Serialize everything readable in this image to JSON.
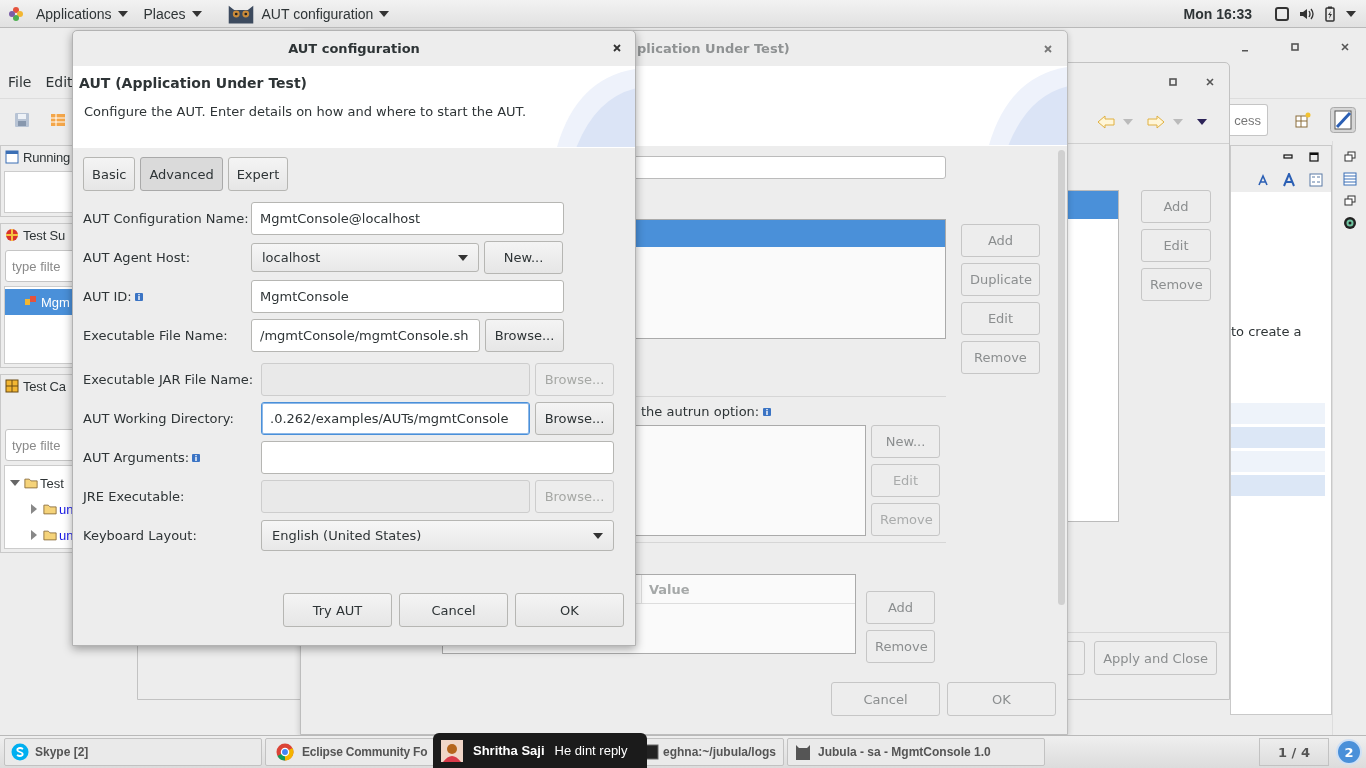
{
  "top_bar": {
    "menus": [
      {
        "label": "Applications"
      },
      {
        "label": "Places"
      }
    ],
    "active_window": "AUT configuration",
    "clock": "Mon 16:33"
  },
  "eclipse": {
    "menus": [
      "File",
      "Edit"
    ],
    "quick_access": "cess",
    "views": [
      {
        "title": "Running",
        "kind": "blank"
      },
      {
        "title": "Test Su",
        "kind": "list",
        "filter_placeholder": "type filte",
        "items": [
          {
            "label": "Mgm",
            "selected": true
          }
        ]
      },
      {
        "title": "Test Ca",
        "kind": "tree",
        "filter_placeholder": "type filte",
        "tree": [
          {
            "label": "Test",
            "expanded": true,
            "children": [
              {
                "label": "un",
                "expanded": false
              },
              {
                "label": "un",
                "expanded": false
              }
            ]
          }
        ]
      }
    ],
    "editor_text": "to create a"
  },
  "preferences": {
    "buttons": [
      {
        "label": "Add"
      },
      {
        "label": "Edit"
      },
      {
        "label": "Remove"
      }
    ],
    "footer_buttons": [
      "Apply and Close"
    ]
  },
  "aut_dialog": {
    "title": "plication Under Test)",
    "list_buttons": [
      {
        "label": "Add",
        "disabled": false
      },
      {
        "label": "Duplicate",
        "disabled": false
      },
      {
        "label": "Edit",
        "disabled": false
      },
      {
        "label": "Remove",
        "disabled": false
      }
    ],
    "autrun_label": "the autrun option:",
    "autrun_buttons": [
      {
        "label": "New...",
        "disabled": false
      },
      {
        "label": "Edit",
        "disabled": true
      },
      {
        "label": "Remove",
        "disabled": true
      }
    ],
    "table_column": "Value",
    "table_buttons": [
      {
        "label": "Add",
        "disabled": false
      },
      {
        "label": "Remove",
        "disabled": false
      }
    ],
    "footer_buttons": [
      "Cancel",
      "OK"
    ]
  },
  "config_dialog": {
    "title": "AUT configuration",
    "heading": "AUT (Application Under Test)",
    "description": "Configure the AUT. Enter details on how and where to start the AUT.",
    "tabs": [
      {
        "label": "Basic",
        "selected": false
      },
      {
        "label": "Advanced",
        "selected": true
      },
      {
        "label": "Expert",
        "selected": false
      }
    ],
    "sections": [
      {
        "fields": [
          {
            "label": "AUT Configuration Name:",
            "kind": "text",
            "value": "MgmtConsole@localhost",
            "info": false,
            "disabled": false,
            "focused": false
          },
          {
            "label": "AUT Agent Host:",
            "kind": "combo",
            "value": "localhost",
            "info": false,
            "disabled": false,
            "focused": false,
            "button": {
              "label": "New...",
              "disabled": false
            }
          },
          {
            "label": "AUT ID:",
            "kind": "text",
            "value": "MgmtConsole",
            "info": true,
            "disabled": false,
            "focused": false
          },
          {
            "label": "Executable File Name:",
            "kind": "text",
            "value": "/mgmtConsole/mgmtConsole.sh",
            "info": false,
            "disabled": false,
            "focused": false,
            "button": {
              "label": "Browse...",
              "disabled": false
            }
          }
        ]
      },
      {
        "fields": [
          {
            "label": "Executable JAR File Name:",
            "kind": "text",
            "info": false,
            "disabled": true,
            "focused": false,
            "button": {
              "label": "Browse...",
              "disabled": true
            }
          },
          {
            "label": "AUT Working Directory:",
            "kind": "text",
            "value": ".0.262/examples/AUTs/mgmtConsole",
            "info": false,
            "disabled": false,
            "focused": true,
            "button": {
              "label": "Browse...",
              "disabled": false
            }
          },
          {
            "label": "AUT Arguments:",
            "kind": "text",
            "info": true,
            "disabled": false,
            "focused": false
          },
          {
            "label": "JRE Executable:",
            "kind": "text",
            "info": false,
            "disabled": true,
            "focused": false,
            "button": {
              "label": "Browse...",
              "disabled": true
            }
          },
          {
            "label": "Keyboard Layout:",
            "kind": "combo",
            "value": "English (United States)",
            "info": false,
            "disabled": false,
            "focused": false
          }
        ]
      }
    ],
    "buttons": [
      "Try AUT",
      "Cancel",
      "OK"
    ]
  },
  "taskbar": {
    "items": [
      {
        "label": "Skype [2]",
        "kind": "skype"
      },
      {
        "label": "Eclipse Community Fo",
        "kind": "browser"
      },
      {
        "label": "eghna:~/jubula/logs",
        "kind": "terminal"
      },
      {
        "label": "Jubula - sa - MgmtConsole 1.0",
        "kind": "jubula"
      }
    ],
    "workspace": "1 / 4",
    "badge": "2"
  },
  "notification": {
    "name": "Shritha Saji",
    "message": "He dint reply"
  }
}
